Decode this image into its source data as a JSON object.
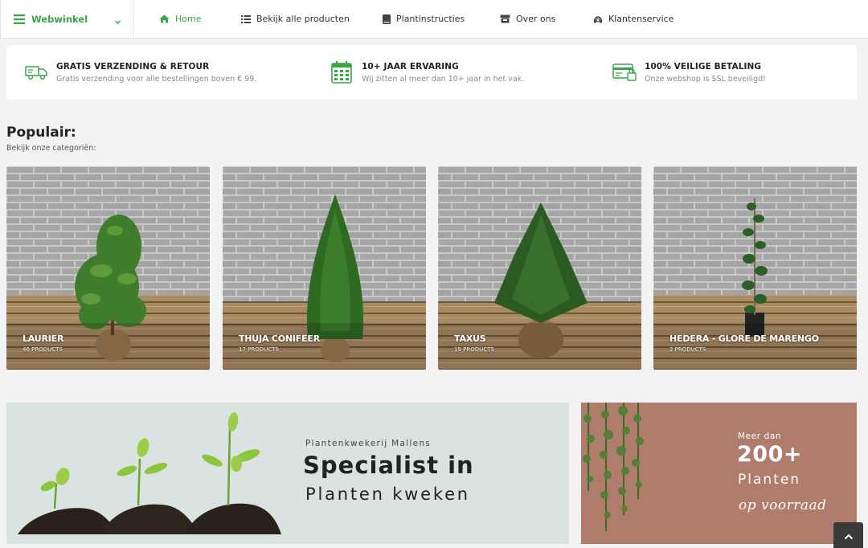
{
  "nav": {
    "shop_label": "Webwinkel",
    "items": [
      {
        "label": "Home",
        "icon": "home-icon"
      },
      {
        "label": "Bekijk alle producten",
        "icon": "list-icon"
      },
      {
        "label": "Plantinstructies",
        "icon": "book-icon"
      },
      {
        "label": "Over ons",
        "icon": "store-icon"
      },
      {
        "label": "Klantenservice",
        "icon": "headset-icon"
      }
    ],
    "accent": "#3aa546"
  },
  "usp": [
    {
      "title": "GRATIS VERZENDING & RETOUR",
      "sub": "Gratis verzending voor alle bestellingen boven € 99.",
      "icon": "truck-icon"
    },
    {
      "title": "10+ JAAR ERVARING",
      "sub": "Wij zitten al meer dan 10+ jaar in het vak.",
      "icon": "calendar-icon"
    },
    {
      "title": "100% VEILIGE BETALING",
      "sub": "Onze webshop is SSL beveiligd!",
      "icon": "secure-payment-icon"
    }
  ],
  "popular": {
    "title": "Populair:",
    "subtitle": "Bekijk onze categoriën:",
    "cards": [
      {
        "name": "LAURIER",
        "count": "46 PRODUCTS"
      },
      {
        "name": "THUJA CONIFEER",
        "count": "17 PRODUCTS"
      },
      {
        "name": "TAXUS",
        "count": "19 PRODUCTS"
      },
      {
        "name": "HEDERA - GLORE DE MARENGO",
        "count": "2 PRODUCTS"
      }
    ]
  },
  "banner_specialist": {
    "kicker": "Plantenkwekerij Mallens",
    "headline": "Specialist in",
    "line2": "Planten kweken"
  },
  "banner_stock": {
    "meer": "Meer dan",
    "number": "200+",
    "planten": "Planten",
    "script": "op voorraad"
  }
}
